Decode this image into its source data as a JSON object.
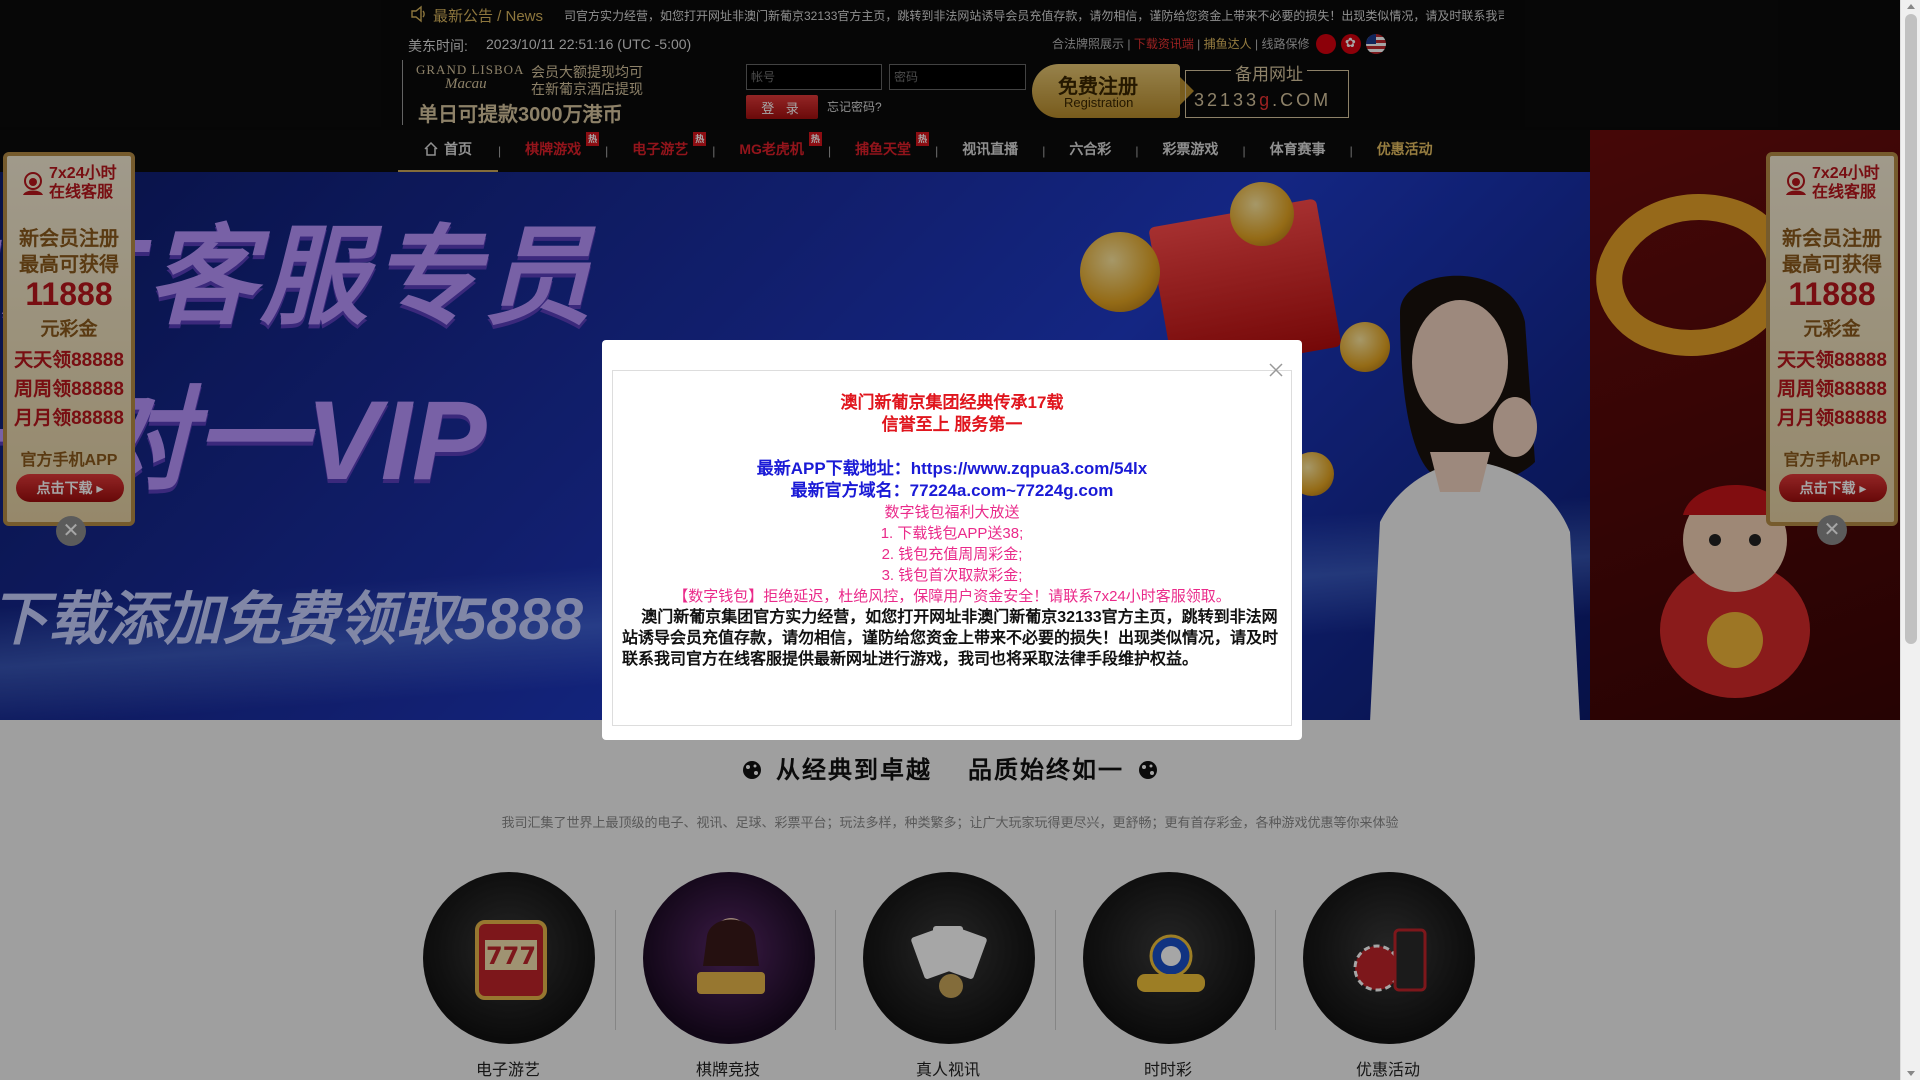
{
  "header": {
    "news_icon": "speaker-icon",
    "news_label": "最新公告 / News",
    "news_text": "司官方实力经营，如您打开网址非澳门新葡京32133官方主页，跳转到非法网站诱导会员充值存款，请勿相信，谨防给您资金上带来不必要的损失！出现类似情况，请及时联系我司",
    "time_label": "美东时间:",
    "time_value": "2023/10/11 22:51:16 (UTC -5:00)",
    "logo": {
      "brand": "GRAND LISBOA",
      "city": "Macau",
      "line1": "会员大额提现均可",
      "line2": "在新葡京酒店提现",
      "slogan": "单日可提款3000万港币"
    },
    "top_links": {
      "license": "合法牌照展示",
      "download": "下载资讯端",
      "fishing": "捕鱼达人",
      "maintenance": "线路保修"
    },
    "flags": [
      "china-flag-icon",
      "hongkong-flag-icon",
      "usa-flag-icon"
    ],
    "login": {
      "username_placeholder": "帐号",
      "password_placeholder": "密码",
      "button": "登 录",
      "forgot": "忘记密码?"
    },
    "register": {
      "main": "免费注册",
      "sub": "Registration"
    },
    "backup": {
      "label": "备用网址",
      "url_prefix": "32133",
      "url_mid": "g",
      "url_suffix": ".COM"
    }
  },
  "nav": {
    "items": [
      {
        "label": "首页",
        "hot": false
      },
      {
        "label": "棋牌游戏",
        "hot": true
      },
      {
        "label": "电子游艺",
        "hot": true
      },
      {
        "label": "MG老虎机",
        "hot": true
      },
      {
        "label": "捕鱼天堂",
        "hot": true
      },
      {
        "label": "视讯直播",
        "hot": false
      },
      {
        "label": "六合彩",
        "hot": false
      },
      {
        "label": "彩票游戏",
        "hot": false
      },
      {
        "label": "体育赛事",
        "hot": false
      },
      {
        "label": "优惠活动",
        "hot": false
      }
    ],
    "hot_badge": "热",
    "separator": "|"
  },
  "banner": {
    "text1": "IAT客服专员",
    "text2": "一对一VIP",
    "text3": "下载添加免费领取5888"
  },
  "side_ad": {
    "cs_line1": "7x24小时",
    "cs_line2": "在线客服",
    "signup_line1": "新会员注册",
    "signup_line2": "最高可获得",
    "amount": "11888",
    "unit": "元彩金",
    "daily": "天天领88888",
    "weekly": "周周领88888",
    "monthly": "月月领88888",
    "app": "官方手机APP",
    "download_button": "点击下载",
    "close": "✕"
  },
  "modal": {
    "close_icon": "close-icon",
    "heading1": "澳门新葡京集团经典传承17载",
    "heading2": "信誉至上 服务第一",
    "app_label": "最新APP下载地址：",
    "app_url": "https://www.zqpua3.com/54lx",
    "domain_label": "最新官方域名：",
    "domain_value": "77224a.com~77224g.com",
    "wallet_title": "数字钱包福利大放送",
    "wallet_1": "1. 下载钱包APP送38;",
    "wallet_2": "2. 钱包充值周周彩金;",
    "wallet_3": "3. 钱包首次取款彩金;",
    "wallet_notice": "【数字钱包】拒绝延迟，杜绝风控，保障用户资金安全！请联系7x24小时客服领取。",
    "warning": "澳门新葡京集团官方实力经营，如您打开网址非澳门新葡京32133官方主页，跳转到非法网站诱导会员充值存款，请勿相信，谨防给您资金上带来不必要的损失！出现类似情况，请及时联系我司官方在线客服提供最新网址进行游戏，我司也将采取法律手段维护权益。"
  },
  "section": {
    "title_left": "从经典到卓越",
    "title_right": "品质始终如一",
    "description": "我司汇集了世界上最顶级的电子、视讯、足球、彩票平台；玩法多样，种类繁多；让广大玩家玩得更尽兴，更舒畅；更有首存彩金，各种游戏优惠等你来体验",
    "categories": [
      {
        "label": "电子游艺",
        "icon": "slot-machine-icon"
      },
      {
        "label": "棋牌竞技",
        "icon": "card-game-icon"
      },
      {
        "label": "真人视讯",
        "icon": "poker-cards-icon"
      },
      {
        "label": "时时彩",
        "icon": "bingo-icon"
      },
      {
        "label": "优惠活动",
        "icon": "casino-chips-icon"
      }
    ]
  },
  "colors": {
    "header_bg": "#0a0a0a",
    "gold": "#d9c7a0",
    "hot_red": "#e0202a",
    "modal_red": "#e0151d",
    "modal_blue": "#1a1ad6",
    "modal_pink": "#ea2a8a"
  }
}
